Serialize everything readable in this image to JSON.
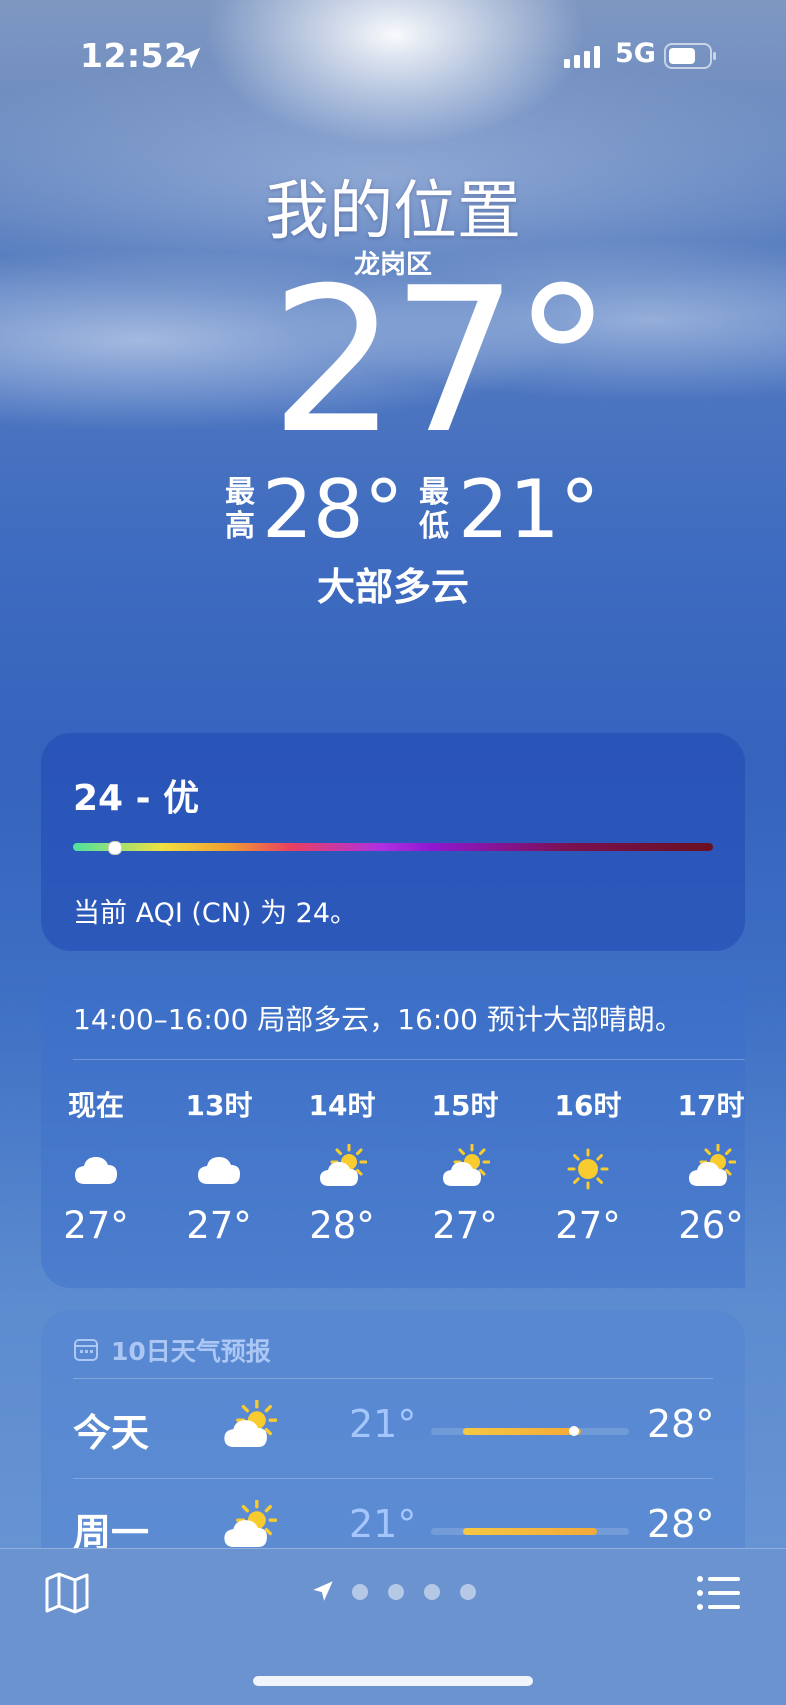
{
  "status_bar": {
    "time": "12:52",
    "network": "5G"
  },
  "hero": {
    "location": "我的位置",
    "district": "龙岗区",
    "temperature": "27°",
    "high_label": "最高",
    "high": "28°",
    "low_label": "最低",
    "low": "21°",
    "condition": "大部多云"
  },
  "aqi": {
    "value_label": "24 - 优",
    "value": 24,
    "description": "当前 AQI (CN) 为 24。"
  },
  "hourly": {
    "summary": "14:00–16:00 局部多云，16:00 预计大部晴朗。",
    "items": [
      {
        "label": "现在",
        "icon": "cloud-icon",
        "temp": "27°"
      },
      {
        "label": "13时",
        "icon": "cloud-icon",
        "temp": "27°"
      },
      {
        "label": "14时",
        "icon": "partly-sunny-icon",
        "temp": "28°"
      },
      {
        "label": "15时",
        "icon": "partly-sunny-icon",
        "temp": "27°"
      },
      {
        "label": "16时",
        "icon": "sun-icon",
        "temp": "27°"
      },
      {
        "label": "17时",
        "icon": "partly-sunny-icon",
        "temp": "26°"
      }
    ]
  },
  "daily": {
    "header": "10日天气预报",
    "days": [
      {
        "name": "今天",
        "icon": "partly-sunny-icon",
        "low": "21°",
        "high": "28°",
        "range_start": 0.16,
        "range_end": 0.76,
        "current_marker": 0.72
      },
      {
        "name": "周一",
        "icon": "partly-sunny-icon",
        "low": "21°",
        "high": "28°",
        "range_start": 0.16,
        "range_end": 0.84
      }
    ]
  },
  "bottom_bar": {
    "page_count": 4,
    "icons": [
      "map-icon",
      "location-arrow-icon",
      "list-icon"
    ]
  }
}
